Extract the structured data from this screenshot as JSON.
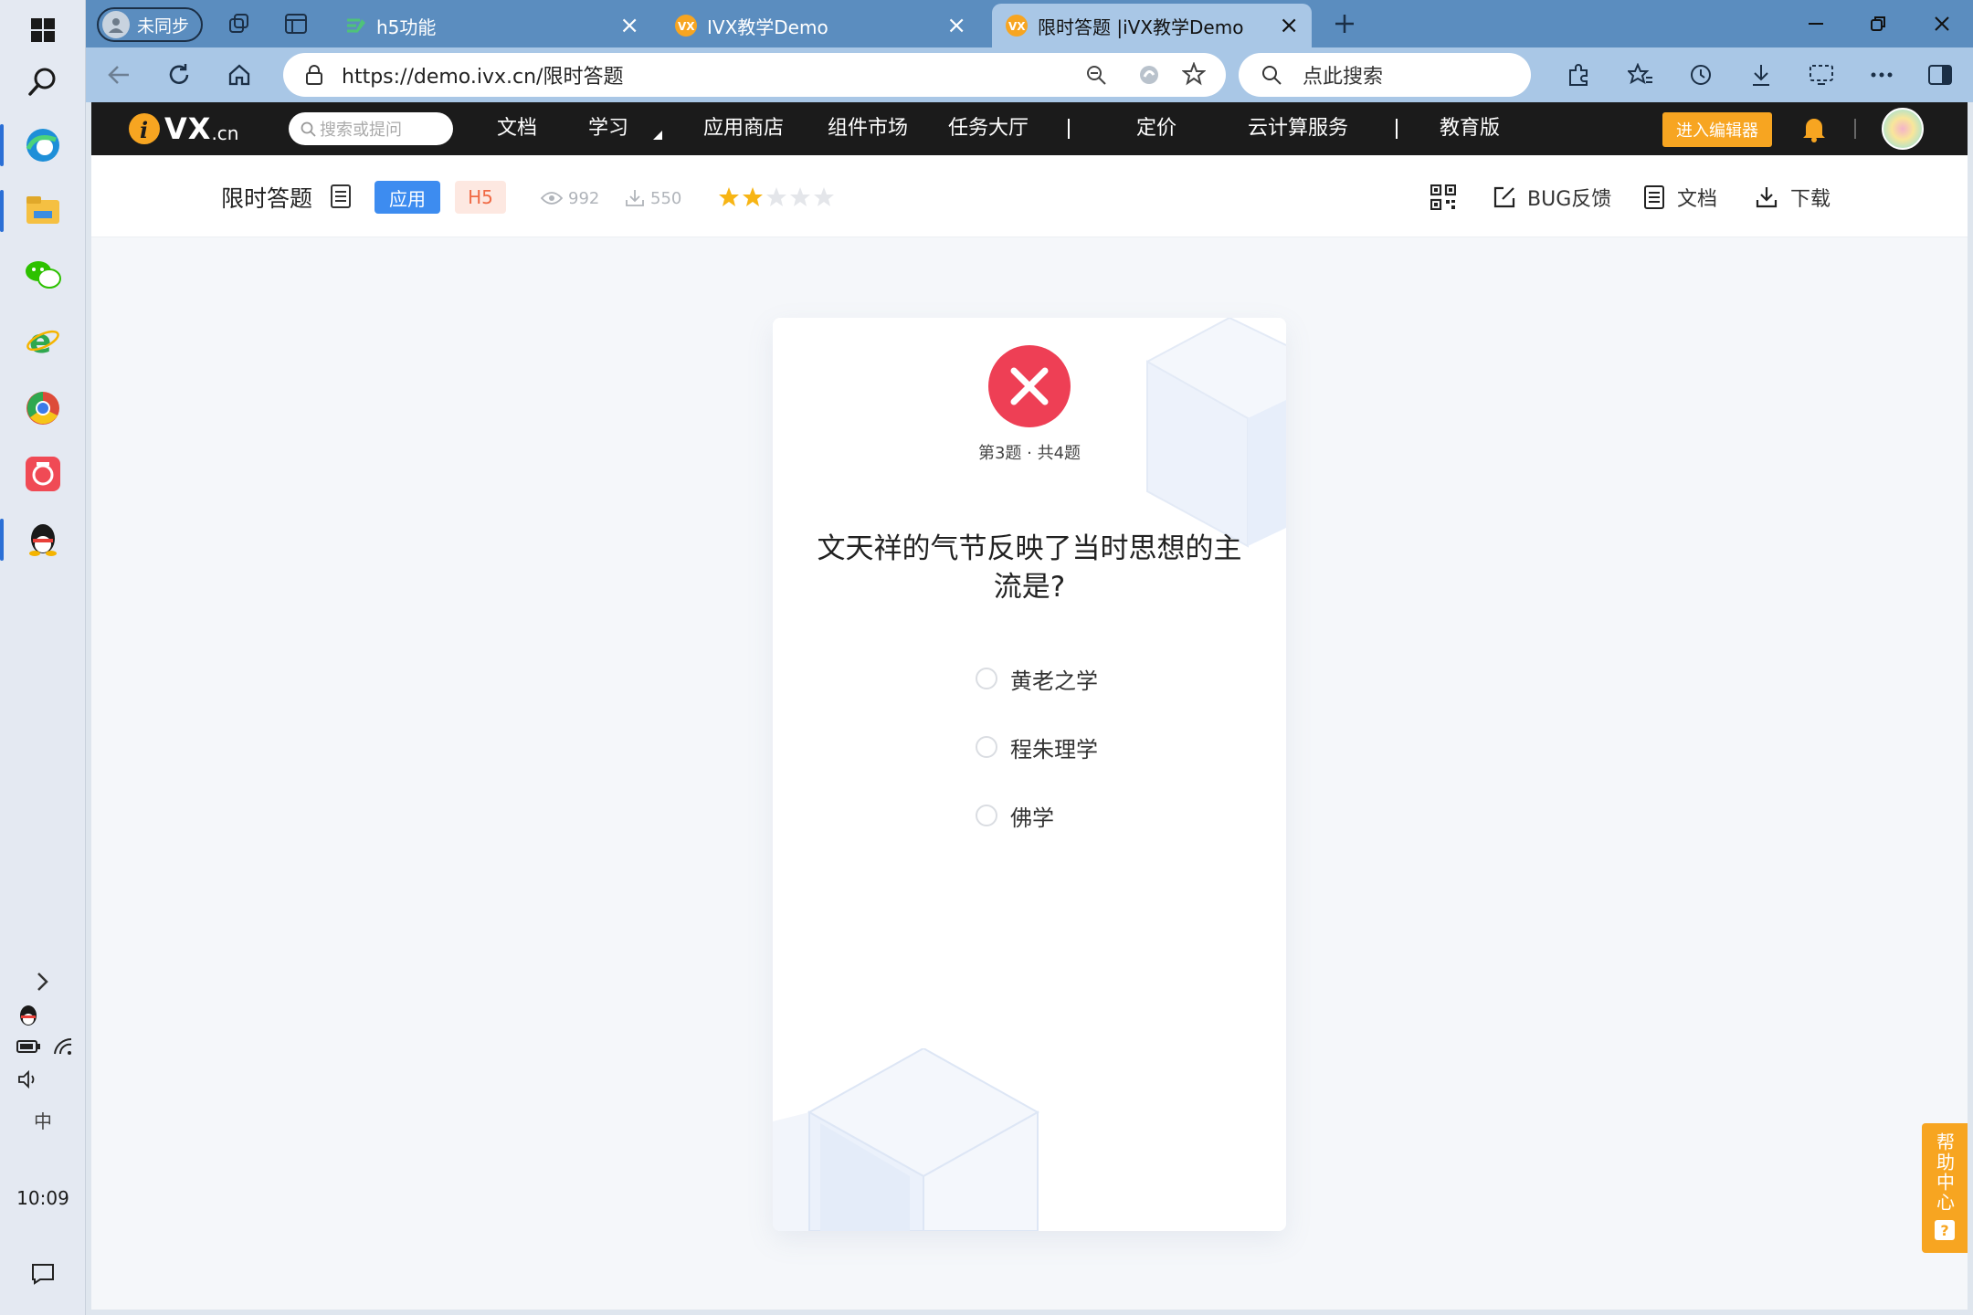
{
  "browser": {
    "profile_label": "未同步",
    "tabs": [
      {
        "title": "h5功能"
      },
      {
        "title": "IVX教学Demo"
      },
      {
        "title": "限时答题 |iVX教学Demo"
      }
    ],
    "url": "https://demo.ivx.cn/限时答题",
    "search_placeholder": "点此搜索"
  },
  "site_nav": {
    "logo_text": "VX",
    "logo_suffix": ".cn",
    "search_placeholder": "搜索或提问",
    "items": [
      "文档",
      "学习",
      "应用商店",
      "组件市场",
      "任务大厅",
      "定价",
      "云计算服务",
      "教育版"
    ],
    "editor_button": "进入编辑器"
  },
  "app_header": {
    "title": "限时答题",
    "tag_app": "应用",
    "tag_h5": "H5",
    "views": "992",
    "downloads": "550",
    "rating": 2,
    "rating_max": 5,
    "actions": {
      "bug": "BUG反馈",
      "docs": "文档",
      "download": "下载"
    }
  },
  "quiz": {
    "progress": "第3题 · 共4题",
    "question": "文天祥的气节反映了当时思想的主流是?",
    "options": [
      "黄老之学",
      "程朱理学",
      "佛学"
    ]
  },
  "help": {
    "label": "帮助中心",
    "icon": "?"
  },
  "taskbar": {
    "time": "10:09",
    "ime": "中"
  },
  "colors": {
    "accent": "#f7a521",
    "wrong": "#ee3f55",
    "tag_app": "#3d8cf0",
    "star": "#f7b515"
  }
}
